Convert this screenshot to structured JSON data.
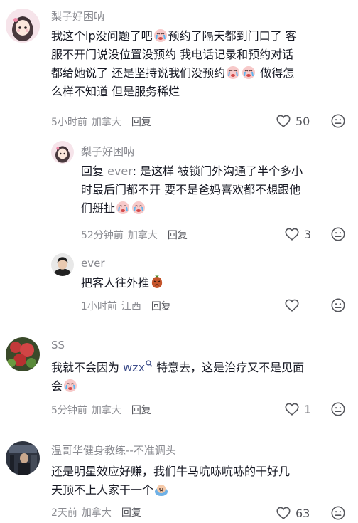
{
  "comments": [
    {
      "username": "梨子好困呐",
      "text_lines": [
        "我这个ip没问题了吧",
        "预约了隔天都到门口了 客",
        "服不开门说没位置没预约 我电话记录和预约对话",
        "都给她说了 还是坚持说我们没预约",
        "做得怎",
        "么样不知道 但是服务稀烂"
      ],
      "time": "5小时前",
      "location": "加拿大",
      "reply_label": "回复",
      "likes": "50"
    },
    {
      "username": "梨子好困呐",
      "reply_prefix": "回复",
      "reply_to": "ever",
      "text_lines": [
        ": 是这样 被锁门外沟通了半个多小",
        "时最后门都不开 要不是爸妈喜欢都不想跟他",
        "们掰扯"
      ],
      "time": "52分钟前",
      "location": "加拿大",
      "reply_label": "回复",
      "likes": "3"
    },
    {
      "username": "ever",
      "text_lines": [
        "把客人往外推"
      ],
      "time": "1小时前",
      "location": "江西",
      "reply_label": "回复",
      "likes": ""
    },
    {
      "username": "SS",
      "text_lines": [
        "我就不会因为 ",
        "wzx",
        " 特意去，这是治疗又不是见面",
        "会"
      ],
      "time": "5分钟前",
      "location": "加拿大",
      "reply_label": "回复",
      "likes": "1"
    },
    {
      "username": "温哥华健身教练--不准调头",
      "text_lines": [
        "还是明星效应好赚，我们牛马吭哧吭哧的干好几",
        "天顶不上人家干一个"
      ],
      "time": "2天前",
      "location": "加拿大",
      "reply_label": "回复",
      "likes": "63"
    }
  ],
  "colors": {
    "text": "#161823",
    "meta": "#8a8b91",
    "link": "#3f4f8c"
  }
}
